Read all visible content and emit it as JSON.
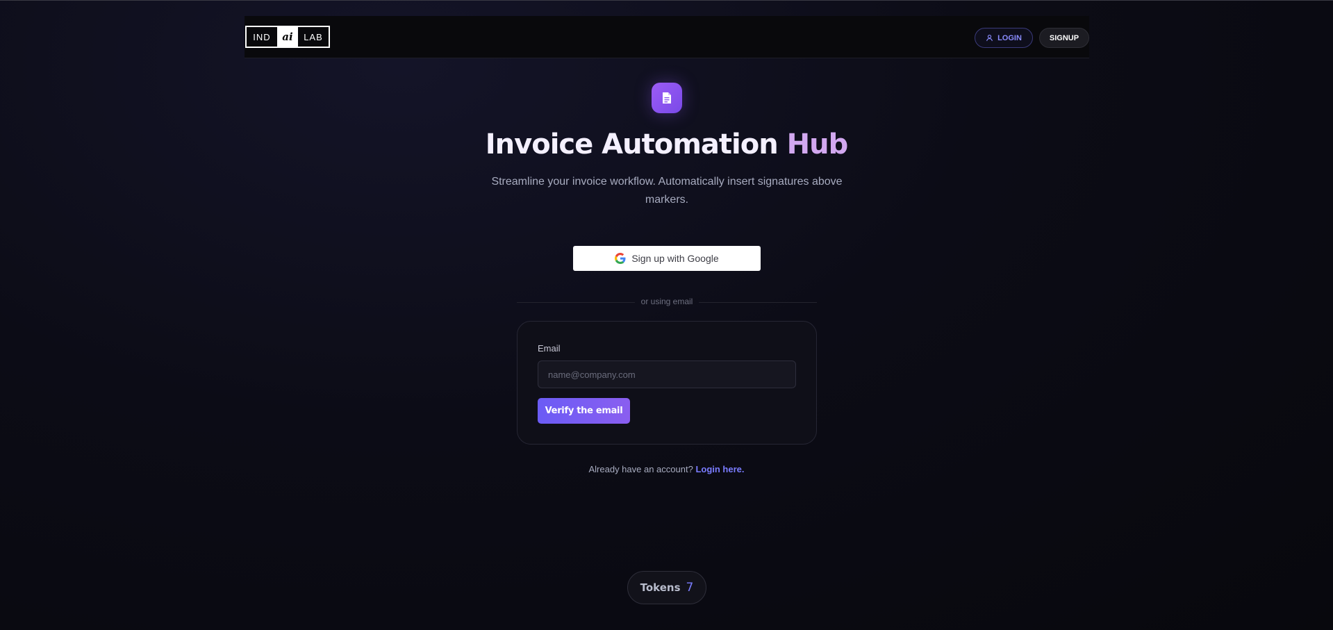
{
  "header": {
    "logo": {
      "part1": "IND",
      "part2": "ai",
      "part3": "LAB"
    },
    "login_label": "LOGIN",
    "signup_label": "SIGNUP"
  },
  "hero": {
    "icon": "document-icon",
    "title_main": "Invoice Automation",
    "title_accent": "Hub",
    "subtitle": "Streamline your invoice workflow. Automatically insert signatures above markers."
  },
  "auth": {
    "google_button": "Sign up with Google",
    "divider_text": "or using email",
    "email_label": "Email",
    "email_placeholder": "name@company.com",
    "email_value": "",
    "verify_button": "Verify the email",
    "already_text": "Already have an account?",
    "login_link": "Login here."
  },
  "tokens": {
    "label": "Tokens",
    "value": "7"
  },
  "colors": {
    "accent": "#7a7cff",
    "brand_purple": "#9c5cf5",
    "title_accent": "#d2a8f0",
    "background": "#0a0a10"
  }
}
